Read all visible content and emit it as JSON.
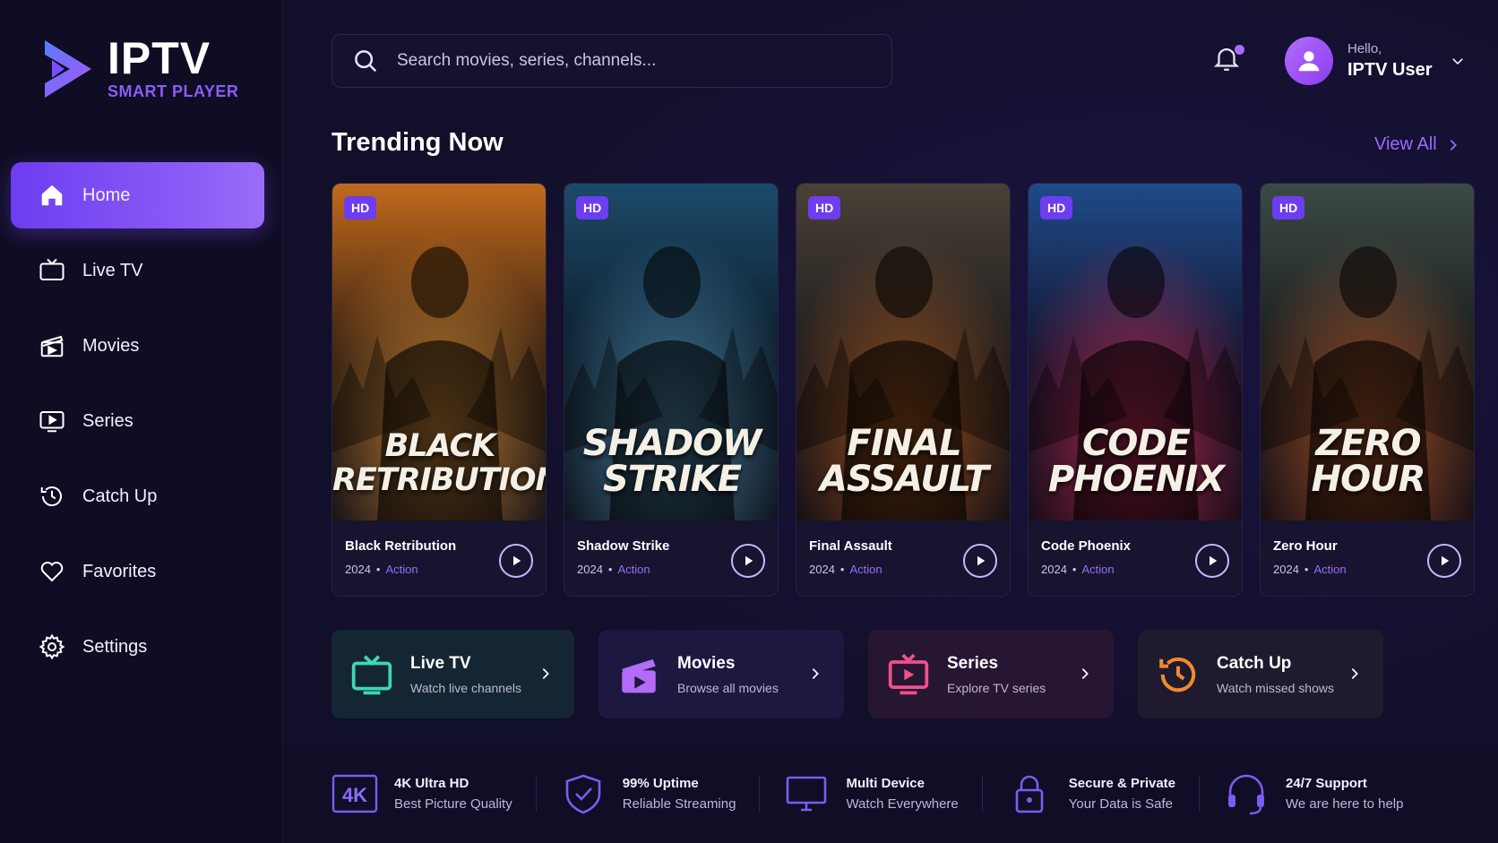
{
  "app": {
    "title": "IPTV",
    "subtitle": "SMART PLAYER"
  },
  "sidebar": {
    "items": [
      {
        "label": "Home",
        "icon": "home-icon",
        "active": true
      },
      {
        "label": "Live TV",
        "icon": "tv-icon",
        "active": false
      },
      {
        "label": "Movies",
        "icon": "clapperboard-icon",
        "active": false
      },
      {
        "label": "Series",
        "icon": "play-screen-icon",
        "active": false
      },
      {
        "label": "Catch Up",
        "icon": "history-icon",
        "active": false
      },
      {
        "label": "Favorites",
        "icon": "heart-icon",
        "active": false
      },
      {
        "label": "Settings",
        "icon": "gear-icon",
        "active": false
      }
    ]
  },
  "header": {
    "search_placeholder": "Search movies, series, channels...",
    "greeting": "Hello,",
    "username": "IPTV User"
  },
  "trending": {
    "title": "Trending Now",
    "view_all": "View All",
    "cards": [
      {
        "badge": "HD",
        "poster_line1": "BLACK",
        "poster_line2": "RETRIBUTION",
        "name": "Black Retribution",
        "year": "2024",
        "dot": "•",
        "genre": "Action",
        "palette": [
          "#2a1a10",
          "#c26a1c",
          "#f0a040"
        ]
      },
      {
        "badge": "HD",
        "poster_line1": "SHADOW",
        "poster_line2": "STRIKE",
        "name": "Shadow Strike",
        "year": "2024",
        "dot": "•",
        "genre": "Action",
        "palette": [
          "#0a1824",
          "#1d4a6a",
          "#5ba3c8"
        ]
      },
      {
        "badge": "HD",
        "poster_line1": "FINAL",
        "poster_line2": "ASSAULT",
        "name": "Final Assault",
        "year": "2024",
        "dot": "•",
        "genre": "Action",
        "palette": [
          "#1a1a1c",
          "#4a4036",
          "#c0601c"
        ]
      },
      {
        "badge": "HD",
        "poster_line1": "CODE",
        "poster_line2": "PHOENIX",
        "name": "Code Phoenix",
        "year": "2024",
        "dot": "•",
        "genre": "Action",
        "palette": [
          "#10122a",
          "#1f4a8a",
          "#e0305a"
        ]
      },
      {
        "badge": "HD",
        "poster_line1": "ZERO",
        "poster_line2": "HOUR",
        "name": "Zero Hour",
        "year": "2024",
        "dot": "•",
        "genre": "Action",
        "palette": [
          "#16191a",
          "#3c4a46",
          "#d0602a"
        ]
      }
    ]
  },
  "quick_links": [
    {
      "title": "Live TV",
      "subtitle": "Watch live channels",
      "icon": "tv-icon",
      "color": "#3ed6b8",
      "bg": "#142634"
    },
    {
      "title": "Movies",
      "subtitle": "Browse all movies",
      "icon": "clapperboard-icon",
      "color": "#b26cf8",
      "bg": "#1d1840"
    },
    {
      "title": "Series",
      "subtitle": "Explore TV series",
      "icon": "play-screen-icon",
      "color": "#f0508a",
      "bg": "#261632"
    },
    {
      "title": "Catch Up",
      "subtitle": "Watch missed shows",
      "icon": "history-icon",
      "color": "#f08a30",
      "bg": "#1f1a2e"
    }
  ],
  "features": [
    {
      "title": "4K Ultra HD",
      "subtitle": "Best Picture Quality",
      "icon": "4k-icon",
      "badge": "4K"
    },
    {
      "title": "99% Uptime",
      "subtitle": "Reliable Streaming",
      "icon": "shield-check-icon"
    },
    {
      "title": "Multi Device",
      "subtitle": "Watch Everywhere",
      "icon": "monitor-icon"
    },
    {
      "title": "Secure & Private",
      "subtitle": "Your Data is Safe",
      "icon": "lock-icon"
    },
    {
      "title": "24/7 Support",
      "subtitle": "We are here to help",
      "icon": "headset-icon"
    }
  ],
  "colors": {
    "accent": "#8b5cf6",
    "background": "#120f2a",
    "sidebar": "#0f0d24"
  }
}
